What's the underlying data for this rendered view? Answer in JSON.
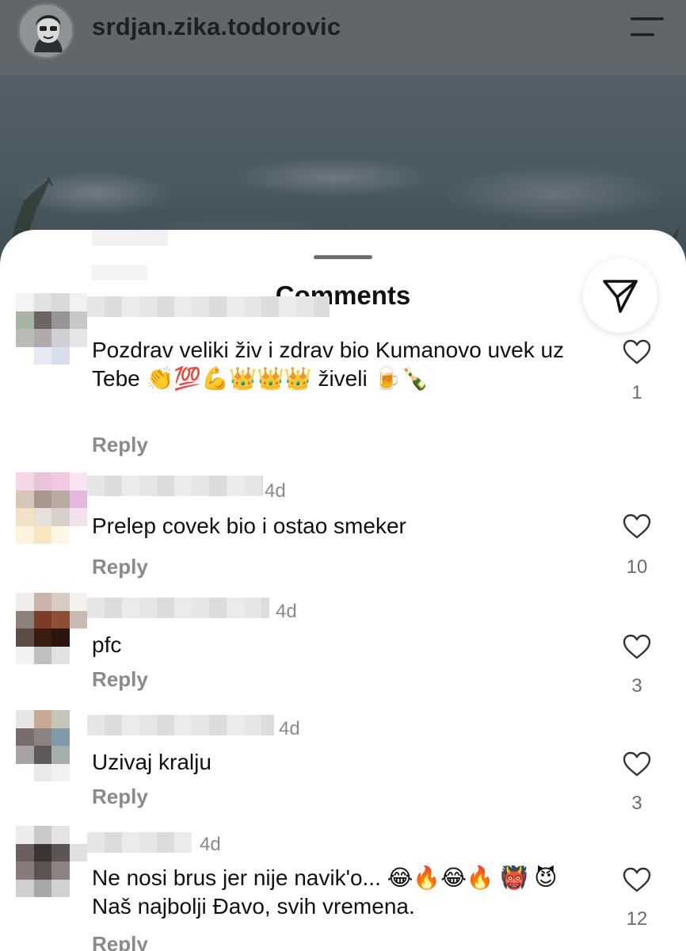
{
  "header": {
    "username": "srdjan.zika.todorovic"
  },
  "sheet": {
    "title": "Comments"
  },
  "comments": [
    {
      "time": "",
      "text": "Pozdrav veliki živ i zdrav bio Kumanovo uvek uz Tebe 👏💯💪👑👑👑 živeli 🍺🍾",
      "reply_label": "Reply",
      "likes": "1"
    },
    {
      "time": "4d",
      "text": "Prelep covek bio i ostao smeker",
      "reply_label": "Reply",
      "likes": "10"
    },
    {
      "time": "4d",
      "text": "pfc",
      "reply_label": "Reply",
      "likes": "3"
    },
    {
      "time": "4d",
      "text": "Uzivaj kralju",
      "reply_label": "Reply",
      "likes": "3"
    },
    {
      "time": "4d",
      "text": "Ne nosi brus jer nije navik'o... 😂🔥😂🔥 👹 😈 Naš najbolji Đavo, svih vremena.",
      "reply_label": "Reply",
      "likes": "12"
    }
  ],
  "icons": {
    "menu": "hamburger-menu-icon",
    "send": "send-icon",
    "like": "heart-outline-icon"
  },
  "colors": {
    "sheet_bg": "#ffffff",
    "muted_text": "#8a8a8a",
    "header_dim": "#60666a"
  }
}
